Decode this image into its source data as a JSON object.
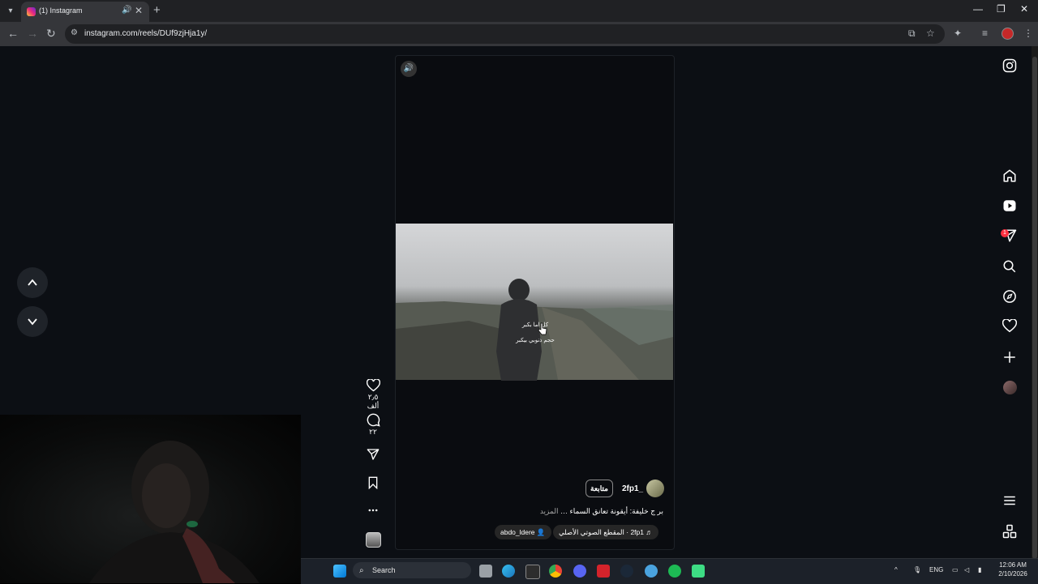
{
  "browser": {
    "tab_title": "(1) Instagram",
    "url": "instagram.com/reels/DUf9zjHja1y/"
  },
  "reel": {
    "username": "2fp1_",
    "follow_label": "متابعة",
    "caption_text": "بر ج خليفة: أيقونة تعانق السماء …",
    "caption_more": "المزيد",
    "audio_label": "2fp1 · المقطع الصوتي الأصلي",
    "tagged_user": "abdo_ldere",
    "subtitle_line1": "كل اما بكبر",
    "subtitle_line2": "حجم ذنوبي بيكبر"
  },
  "actions": {
    "likes": "٢٫٥ ألف",
    "comments": "٢٢"
  },
  "taskbar": {
    "search_label": "Search",
    "language": "ENG",
    "time": "12:06 AM",
    "date": "2/10/2026"
  },
  "colors": {
    "background": "#0c0f14",
    "badge": "#ff3040",
    "tab_bg": "#35363a"
  },
  "notifications": {
    "count": "1"
  }
}
